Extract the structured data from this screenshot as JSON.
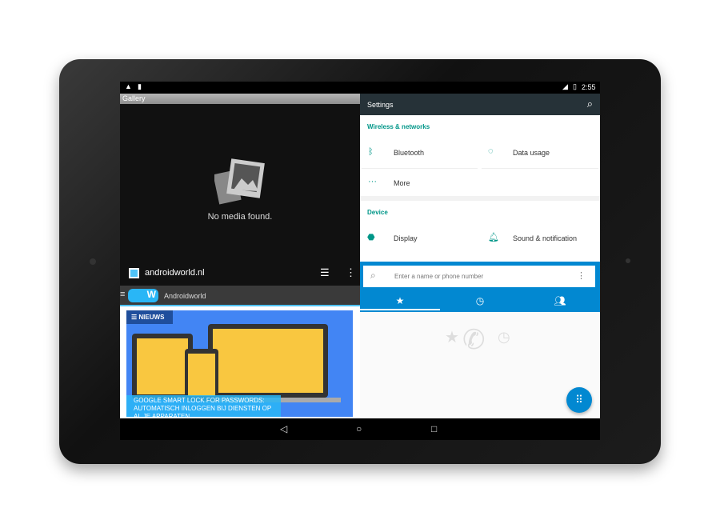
{
  "status_bar": {
    "time": "2:55",
    "icons": [
      "warning-icon",
      "sd-card-icon",
      "signal-icon",
      "battery-icon"
    ]
  },
  "gallery": {
    "title": "Gallery",
    "empty_text": "No media found."
  },
  "settings": {
    "title": "Settings",
    "sections": [
      {
        "header": "Wireless & networks",
        "items": [
          {
            "label": "Bluetooth",
            "icon": "bluetooth-icon"
          },
          {
            "label": "Data usage",
            "icon": "data-usage-icon"
          },
          {
            "label": "More",
            "icon": "more-icon"
          }
        ]
      },
      {
        "header": "Device",
        "items": [
          {
            "label": "Display",
            "icon": "display-icon"
          },
          {
            "label": "Sound & notification",
            "icon": "bell-icon"
          }
        ]
      }
    ]
  },
  "browser": {
    "url": "androidworld.nl",
    "site_name": "Androidworld",
    "badge": "NIEUWS",
    "headline": "GOOGLE SMART LOCK FOR PASSWORDS: AUTOMATISCH INLOGGEN BIJ DIENSTEN OP AL JE APPARATEN"
  },
  "dialer": {
    "search_placeholder": "Enter a name or phone number",
    "tabs": [
      "favorites-icon",
      "recents-icon",
      "contacts-icon"
    ],
    "accent": "#0288d1"
  },
  "colors": {
    "settings_accent": "#009688",
    "settings_bar": "#263238"
  }
}
